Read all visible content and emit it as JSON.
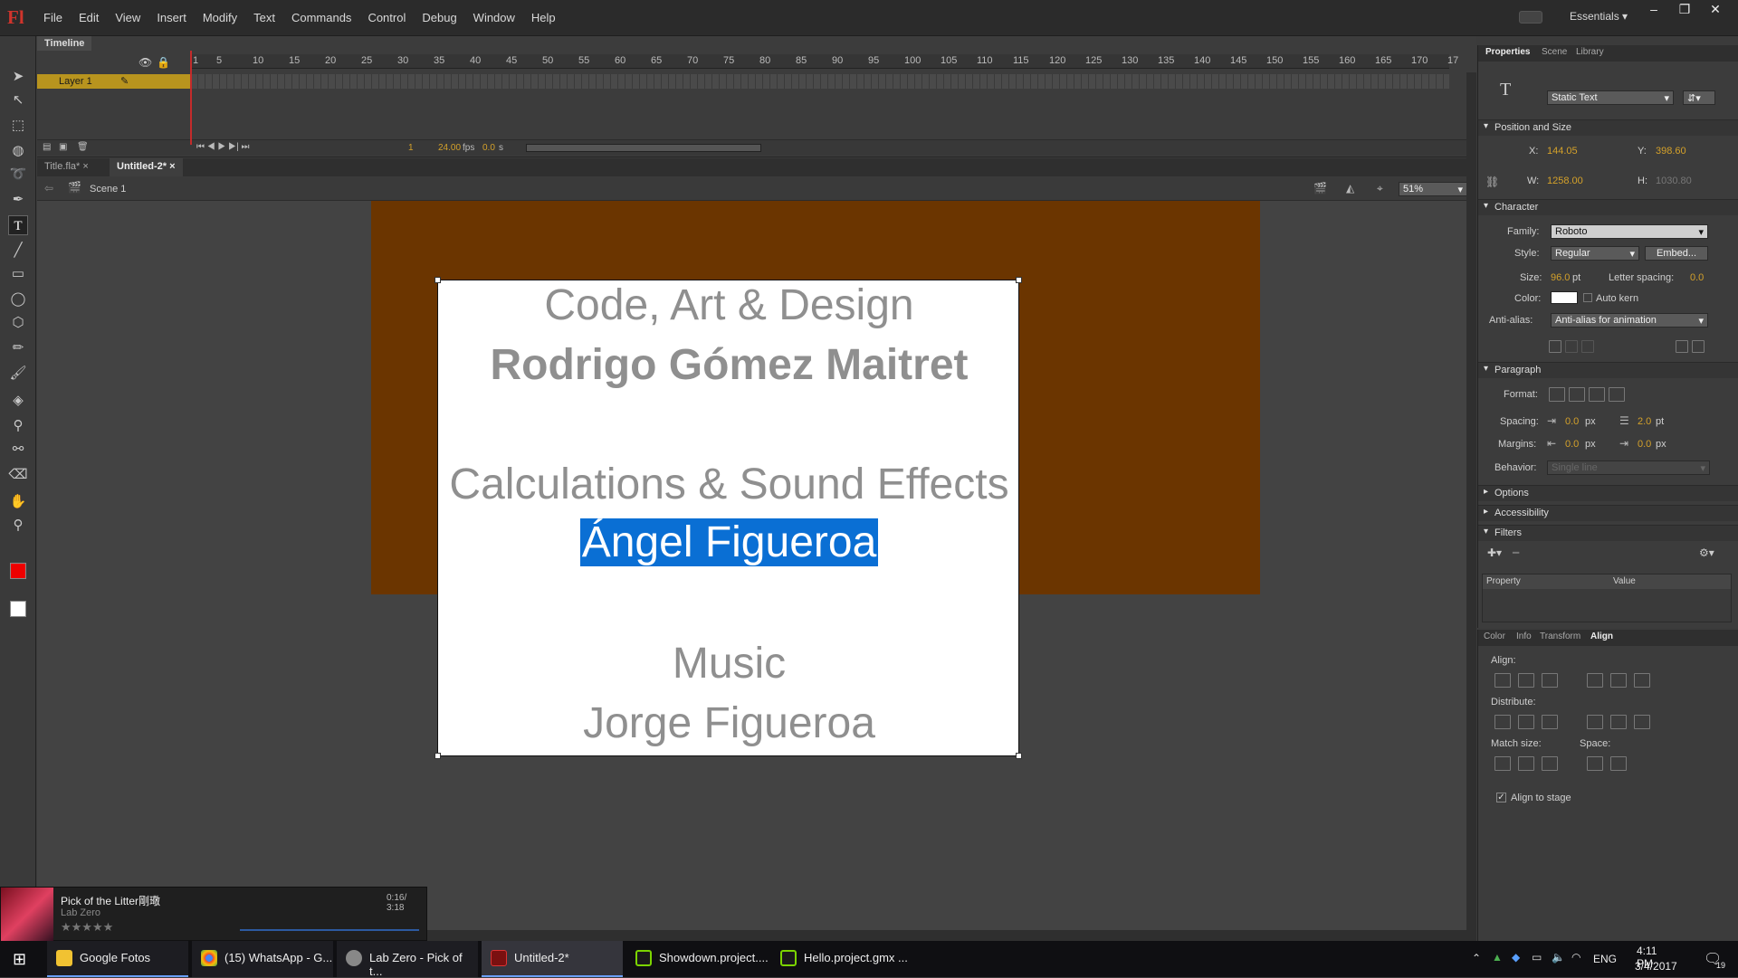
{
  "app": {
    "logo": "Fl",
    "menus": [
      "File",
      "Edit",
      "View",
      "Insert",
      "Modify",
      "Text",
      "Commands",
      "Control",
      "Debug",
      "Window",
      "Help"
    ],
    "workspace": "Essentials"
  },
  "timeline": {
    "tab": "Timeline",
    "layer_name": "Layer 1",
    "ruler_ticks": [
      "1",
      "5",
      "10",
      "15",
      "20",
      "25",
      "30",
      "35",
      "40",
      "45",
      "50",
      "55",
      "60",
      "65",
      "70",
      "75",
      "80",
      "85",
      "90",
      "95",
      "100",
      "105",
      "110",
      "115",
      "120",
      "125",
      "130",
      "135",
      "140",
      "145",
      "150",
      "155",
      "160",
      "165",
      "170",
      "17"
    ],
    "frame": "1",
    "fps": "24.00",
    "fps_unit": "fps",
    "time": "0.0",
    "time_unit": "s"
  },
  "documents": {
    "tabs": [
      "Title.fla*",
      "Untitled-2*"
    ],
    "active": "Untitled-2*",
    "scene": "Scene 1",
    "zoom": "51%"
  },
  "stage": {
    "lines": [
      "Code, Art & Design",
      "Rodrigo Gómez Maitret",
      "Calculations & Sound Effects",
      "Ángel Figueroa",
      "Music",
      "Jorge Figueroa"
    ],
    "background": "#6b3500"
  },
  "properties": {
    "tabs": [
      "Properties",
      "Scene",
      "Library"
    ],
    "text_type": "Static Text",
    "position_size": {
      "title": "Position and Size",
      "x_label": "X:",
      "x": "144.05",
      "y_label": "Y:",
      "y": "398.60",
      "w_label": "W:",
      "w": "1258.00",
      "h_label": "H:",
      "h": "1030.80"
    },
    "character": {
      "title": "Character",
      "family_label": "Family:",
      "family": "Roboto",
      "style_label": "Style:",
      "style": "Regular",
      "embed": "Embed...",
      "size_label": "Size:",
      "size": "96.0",
      "size_unit": "pt",
      "spacing_label": "Letter spacing:",
      "spacing": "0.0",
      "color_label": "Color:",
      "auto_kern": "Auto kern",
      "antialias_label": "Anti-alias:",
      "antialias": "Anti-alias for animation"
    },
    "paragraph": {
      "title": "Paragraph",
      "format_label": "Format:",
      "spacing_label": "Spacing:",
      "indent": "0.0",
      "indent_unit": "px",
      "line_spacing": "2.0",
      "line_unit": "pt",
      "margins_label": "Margins:",
      "left_margin": "0.0",
      "left_unit": "px",
      "right_margin": "0.0",
      "right_unit": "px",
      "behavior_label": "Behavior:",
      "behavior": "Single line"
    },
    "options": "Options",
    "accessibility": "Accessibility",
    "filters": "Filters",
    "filter_cols": [
      "Property",
      "Value"
    ]
  },
  "align": {
    "tabs": [
      "Color",
      "Info",
      "Transform",
      "Align"
    ],
    "align_label": "Align:",
    "distribute_label": "Distribute:",
    "match_label": "Match size:",
    "space_label": "Space:",
    "align_to_stage": "Align to stage"
  },
  "music": {
    "title": "Pick of the Litter剛璥",
    "artist": "Lab Zero",
    "time": "0:16/ 3:18"
  },
  "taskbar": {
    "items": [
      "Google Fotos",
      "(15) WhatsApp - G...",
      "Lab Zero - Pick of t...",
      "Untitled-2*",
      "Showdown.project....",
      "Hello.project.gmx ..."
    ],
    "lang": "ENG",
    "time": "4:11 PM",
    "date": "3/4/2017",
    "notif": "19"
  }
}
